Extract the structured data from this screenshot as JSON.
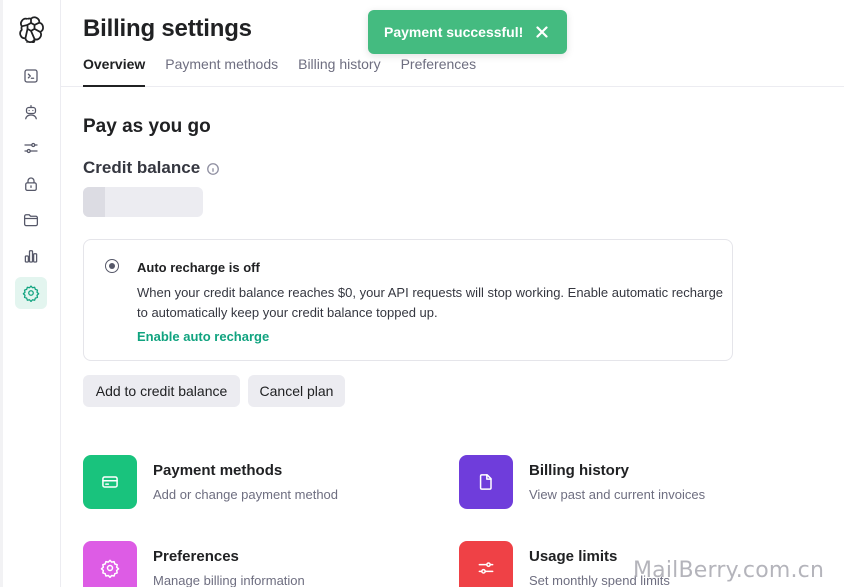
{
  "header": {
    "title": "Billing settings",
    "tabs": [
      {
        "label": "Overview",
        "active": true
      },
      {
        "label": "Payment methods",
        "active": false
      },
      {
        "label": "Billing history",
        "active": false
      },
      {
        "label": "Preferences",
        "active": false
      }
    ]
  },
  "toast": {
    "message": "Payment successful!",
    "color": "#44bb80"
  },
  "sidebar": {
    "logo": "openai-logo-icon",
    "items": [
      {
        "icon": "terminal-icon",
        "active": false
      },
      {
        "icon": "assistant-robot-icon",
        "active": false
      },
      {
        "icon": "sliders-icon",
        "active": false
      },
      {
        "icon": "lock-icon",
        "active": false
      },
      {
        "icon": "folder-icon",
        "active": false
      },
      {
        "icon": "bar-chart-icon",
        "active": false
      },
      {
        "icon": "gear-icon",
        "active": true
      }
    ]
  },
  "main": {
    "section_title": "Pay as you go",
    "credit_label": "Credit balance",
    "credit_loading_progress": 0.18,
    "auto_recharge": {
      "title": "Auto recharge is off",
      "description": "When your credit balance reaches $0, your API requests will stop working. Enable automatic recharge to automatically keep your credit balance topped up.",
      "link": "Enable auto recharge"
    },
    "buttons": {
      "add_credit": "Add to credit balance",
      "cancel_plan": "Cancel plan"
    },
    "cards": [
      {
        "title": "Payment methods",
        "subtitle": "Add or change payment method",
        "icon": "credit-card-icon",
        "color": "#19c37d"
      },
      {
        "title": "Billing history",
        "subtitle": "View past and current invoices",
        "icon": "document-icon",
        "color": "#6f3ddb"
      },
      {
        "title": "Preferences",
        "subtitle": "Manage billing information",
        "icon": "gear-icon",
        "color": "#dd5ce5"
      },
      {
        "title": "Usage limits",
        "subtitle": "Set monthly spend limits",
        "icon": "sliders-icon",
        "color": "#ef4146"
      }
    ]
  },
  "watermark": "MailBerry.com.cn",
  "colors": {
    "accent": "#10a37f",
    "active_nav_bg": "#e3f5ef"
  }
}
